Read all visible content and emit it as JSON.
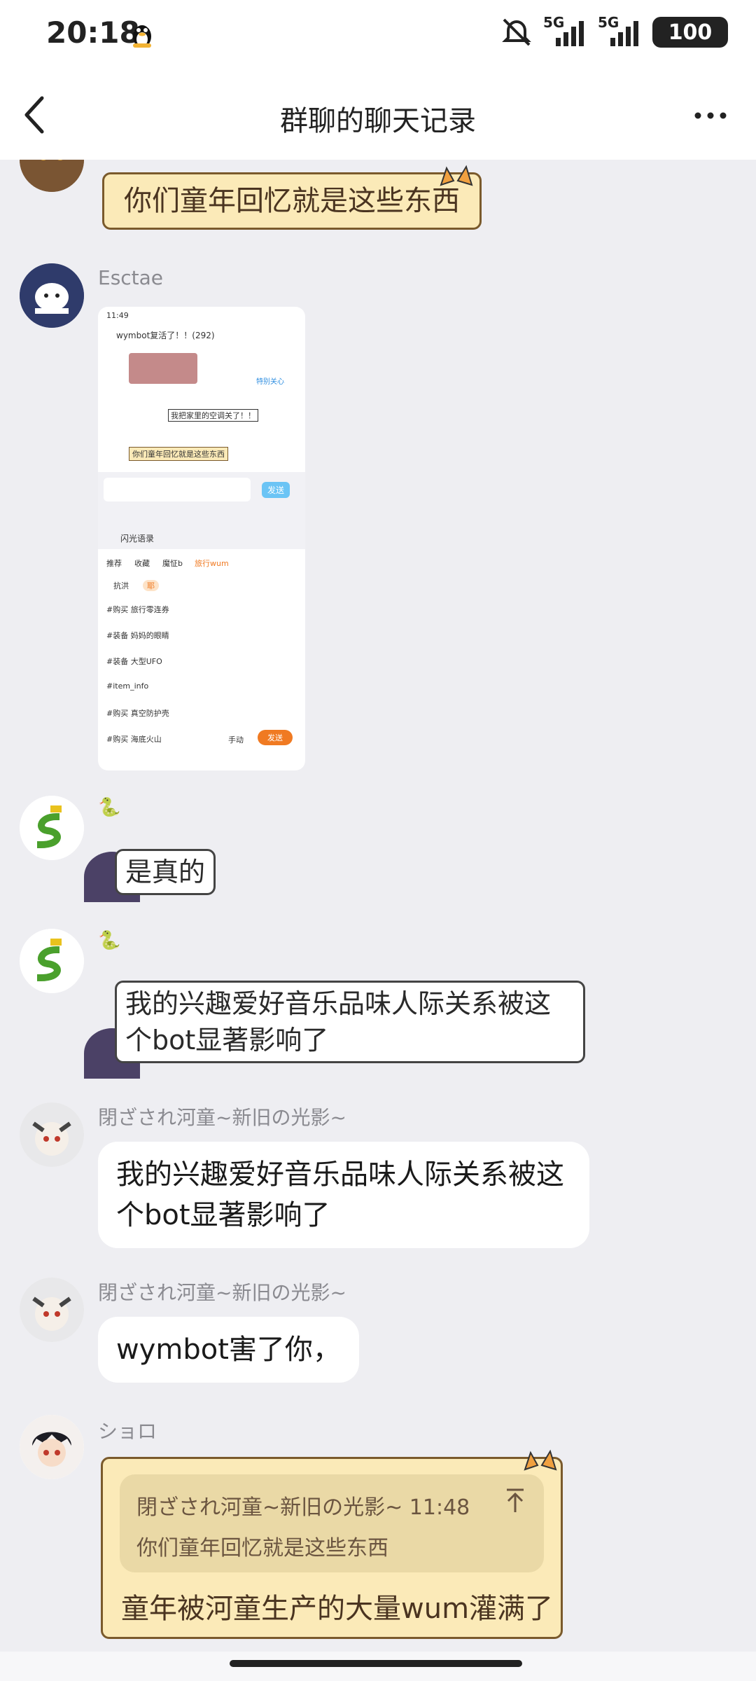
{
  "status_bar": {
    "time": "20:18",
    "net1": "5G",
    "net2": "5G",
    "battery": "100"
  },
  "header": {
    "title": "群聊的聊天记录"
  },
  "messages": {
    "m1": {
      "text": "你们童年回忆就是这些东西"
    },
    "m2": {
      "sender": "Esctae"
    },
    "m3": {
      "emoji": "🐍",
      "text": "是真的"
    },
    "m4": {
      "emoji": "🐍",
      "text": "我的兴趣爱好音乐品味人际关系被这个bot显著影响了"
    },
    "m5": {
      "sender": "閉ざされ河童~新旧の光影~",
      "text": "我的兴趣爱好音乐品味人际关系被这个bot显著影响了"
    },
    "m6": {
      "sender": "閉ざされ河童~新旧の光影~",
      "text": "wymbot害了你，"
    },
    "m7": {
      "sender": "ショロ",
      "quote_meta": "閉ざされ河童~新旧の光影~ 11:48",
      "quote_text": "你们童年回忆就是这些东西",
      "text": "童年被河童生产的大量wum灌满了"
    }
  },
  "screenshot": {
    "time": "11:49",
    "title": "wymbot复活了！！(292)",
    "special": "特别关心",
    "msg1": "我把家里的空调关了！！",
    "msg2": "你们童年回忆就是这些东西",
    "send": "发送",
    "panel_title": "闪光语录",
    "tabs": [
      "推荐",
      "收藏",
      "魔怔b",
      "旅行wum"
    ],
    "chips": [
      "抗洪",
      "耶"
    ],
    "items": [
      "#购买 旅行零连券",
      "#装备 妈妈的眼睛",
      "#装备 大型UFO",
      "#item_info",
      "#购买 真空防护壳",
      "#购买 海底火山"
    ],
    "manual": "手动",
    "send2": "发送"
  },
  "colors": {
    "scroll_bg": "#fbeab8",
    "scroll_border": "#7a5a2c",
    "quote_bg": "#ead9a6",
    "accent_orange": "#f07a22",
    "accent_blue": "#6bc4f5"
  }
}
